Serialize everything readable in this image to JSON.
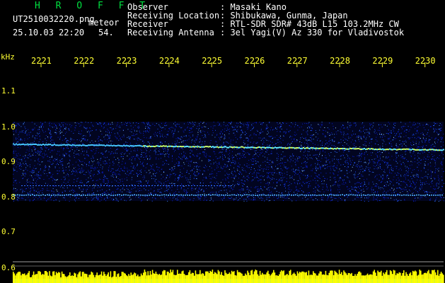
{
  "header": {
    "logo": "H R O F F T",
    "filename": "UT2510032220.png",
    "mode": "meteor",
    "datetime": "25.10.03 22:20",
    "frame": "54.",
    "observer_label": "Observer",
    "observer_value": ": Masaki Kano",
    "location_label": "Receiving Location",
    "location_value": ": Shibukawa, Gunma, Japan",
    "receiver_label": "Receiver",
    "receiver_value": ": RTL-SDR SDR# 43dB L15 103.2MHz CW",
    "antenna_label": "Receiving Antenna",
    "antenna_value": ": 3el Yagi(V) Az 330 for Vladivostok"
  },
  "axis": {
    "y_unit": "kHz",
    "y_ticks": [
      "1.1",
      "1.0",
      "0.9",
      "0.8",
      "0.7",
      "0.6"
    ],
    "time_ticks": [
      "2221",
      "2222",
      "2223",
      "2224",
      "2225",
      "2226",
      "2227",
      "2228",
      "2229",
      "2230"
    ]
  },
  "colors": {
    "background": "#000000",
    "text": "#ffffff",
    "logo": "#00e040",
    "time_labels": "#ffff33",
    "noise_band": "#0a1ed2",
    "signal": "#46c8ff",
    "intensity_bars": "#ffff00",
    "grid_lines": "#a0a0a0"
  }
}
